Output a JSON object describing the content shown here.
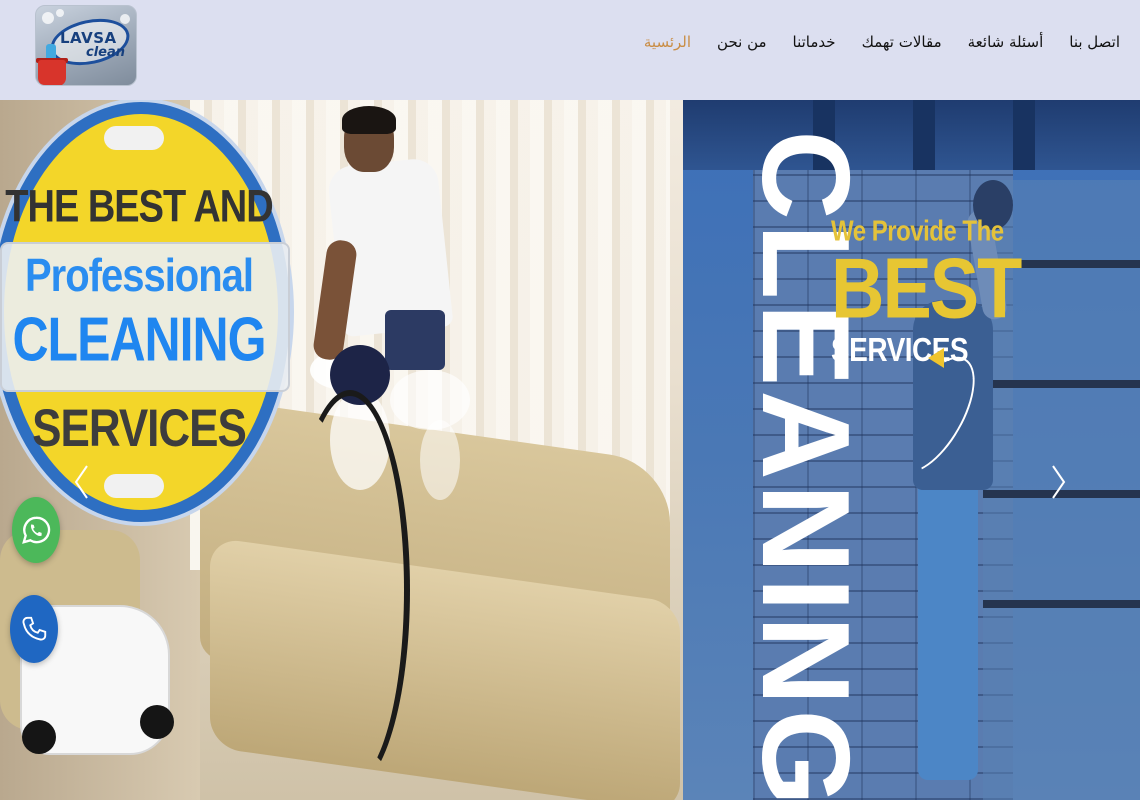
{
  "header": {
    "logo_text": {
      "top": "LAVSA",
      "bottom": "clean"
    },
    "nav": [
      {
        "label": "الرئسية",
        "active": true
      },
      {
        "label": "من نحن",
        "active": false
      },
      {
        "label": "خدماتنا",
        "active": false
      },
      {
        "label": "مقالات تهمك",
        "active": false
      },
      {
        "label": "أسئلة شائعة",
        "active": false
      },
      {
        "label": "اتصل بنا",
        "active": false
      }
    ]
  },
  "hero": {
    "left_slide": {
      "badge_lines": [
        "THE BEST AND",
        "Professional",
        "CLEANING",
        "SERVICES"
      ]
    },
    "right_slide": {
      "vertical_word": "CLEANING",
      "promo_line1": "We Provide The",
      "promo_line2": "BEST",
      "promo_line3": "SERVICES"
    },
    "controls": {
      "prev_icon": "chevron-left-icon",
      "next_icon": "chevron-right-icon"
    }
  },
  "floating_buttons": [
    {
      "icon": "whatsapp-icon"
    },
    {
      "icon": "phone-icon"
    }
  ],
  "colors": {
    "header_bg": "#dcdff0",
    "nav_active": "#c98d45",
    "whatsapp": "#4cb85a",
    "phone": "#1f67c2",
    "badge_yellow": "#f3d629",
    "badge_blue": "#2a8df0",
    "promo_gold": "#e7c633"
  }
}
